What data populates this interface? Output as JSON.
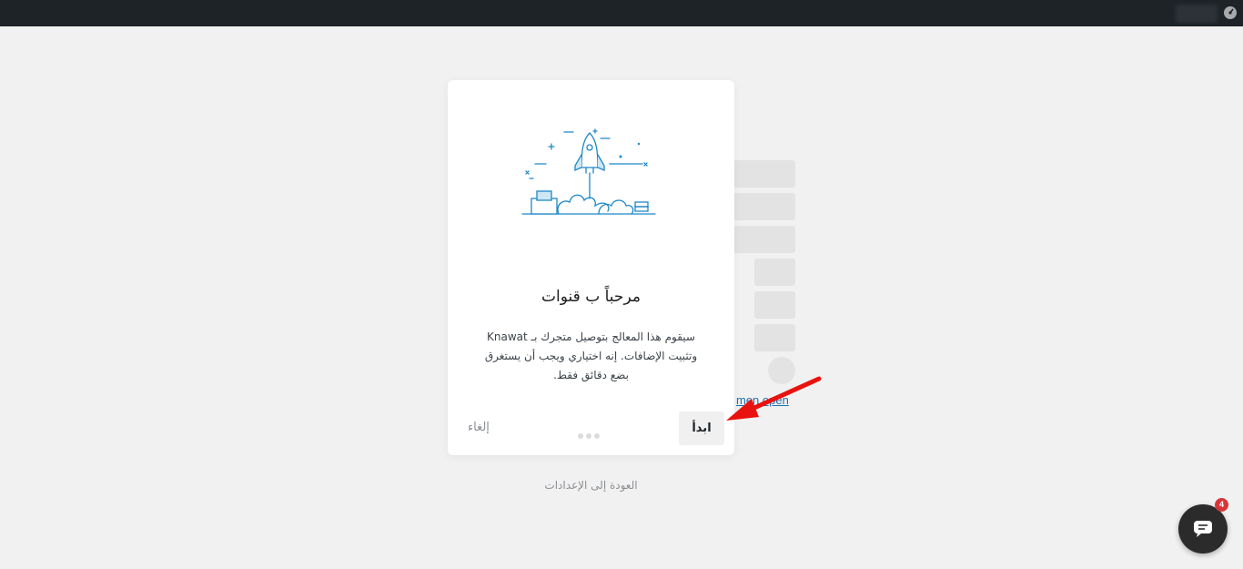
{
  "wizard": {
    "title": "مرحباً ب قنوات",
    "description": "سيقوم هذا المعالج بتوصيل متجرك بـ Knawat وتثبيت الإضافات. إنه اختياري ويجب أن يستغرق بضع دقائق فقط.",
    "start_label": "ابدأ",
    "cancel_label": "إلغاء",
    "back_to_settings": "العودة إلى الإعدادات",
    "illustration_icon": "rocket-launch-illustration"
  },
  "background": {
    "partial_link_text": "men  open"
  },
  "chat": {
    "badge_count": "4",
    "icon": "chat-bubble-icon"
  },
  "colors": {
    "adminbar": "#1d2327",
    "accent_blue": "#2271b1",
    "arrow_red": "#e8130f",
    "badge_red": "#d63638"
  }
}
